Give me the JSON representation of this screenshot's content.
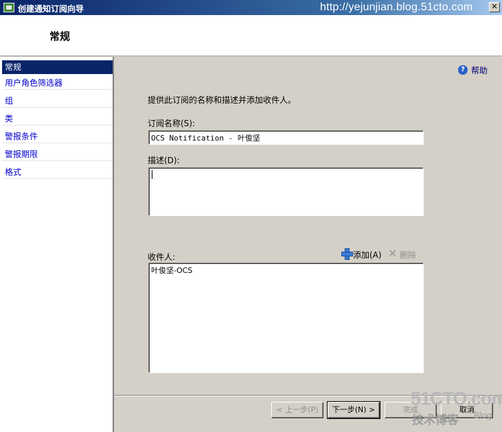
{
  "window": {
    "title": "创建通知订阅向导",
    "watermark_url": "http://yejunjian.blog.51cto.com",
    "close_label": "✕"
  },
  "header": {
    "title": "常规"
  },
  "sidebar": {
    "items": [
      {
        "label": "常规",
        "selected": true
      },
      {
        "label": "用户角色筛选器"
      },
      {
        "label": "组"
      },
      {
        "label": "类"
      },
      {
        "label": "警报条件"
      },
      {
        "label": "警报期限"
      },
      {
        "label": "格式"
      }
    ]
  },
  "help": {
    "label": "帮助",
    "icon": "help-icon"
  },
  "main": {
    "intro": "提供此订阅的名称和描述并添加收件人。",
    "name_label": "订阅名称(S):",
    "name_value": "OCS Notification - 叶俊坚",
    "desc_label": "描述(D):",
    "desc_value": "",
    "recipients_label": "收件人:",
    "add_label": "添加(A)",
    "delete_label": "删除",
    "recipients": [
      "叶俊坚-OCS"
    ]
  },
  "footer": {
    "back_label": "< 上一步(P)",
    "next_label": "下一步(N) >",
    "finish_label": "完成",
    "cancel_label": "取消"
  },
  "watermark": {
    "logo": "51CTO.com",
    "sub": "技术博客",
    "blog": "Blog"
  }
}
